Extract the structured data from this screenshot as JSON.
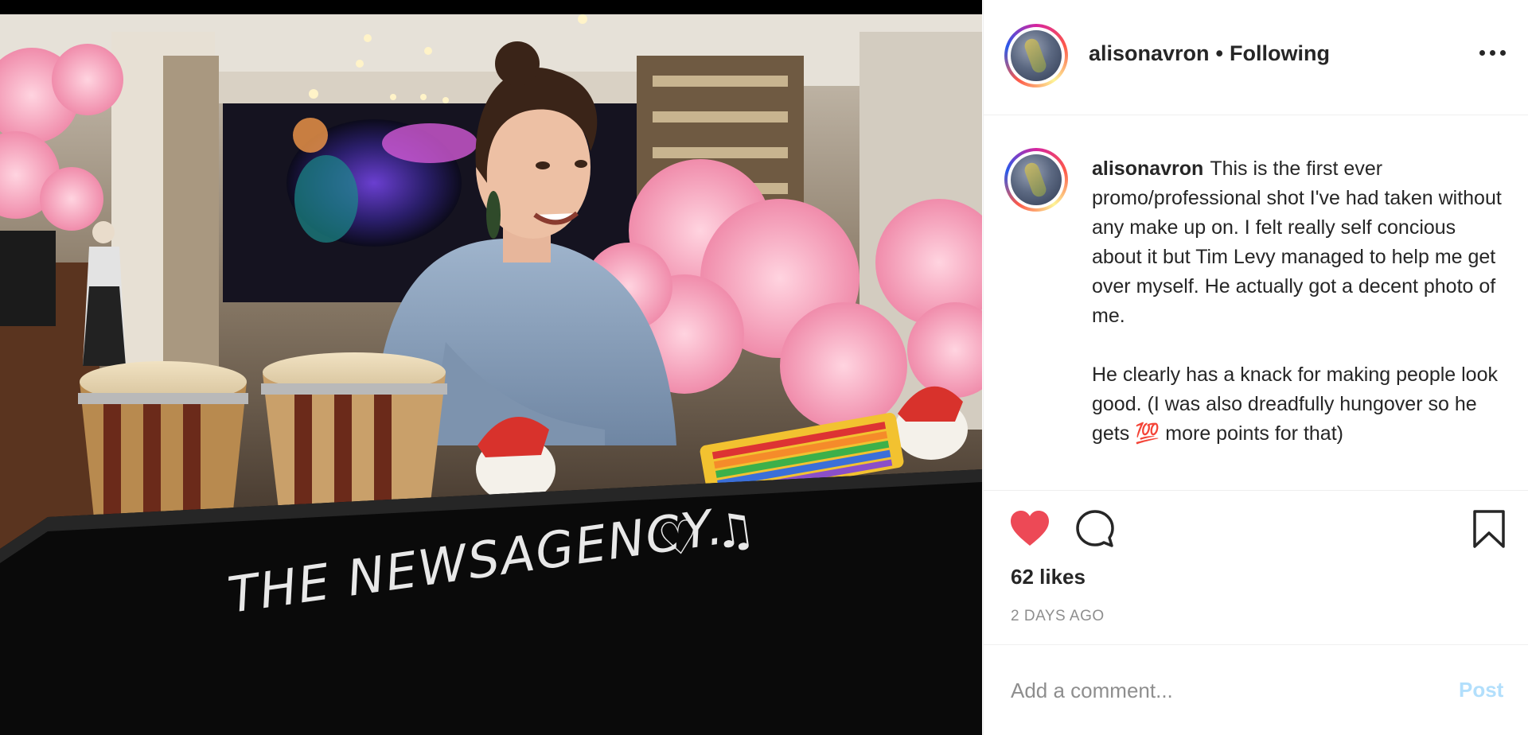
{
  "post": {
    "photo_sign_text": "THE NEWSAGENCY.",
    "photo_sign_symbols": "♡ ♫"
  },
  "header": {
    "username": "alisonavron",
    "separator": "•",
    "follow_status": "Following",
    "more_icon": "more-horizontal-icon"
  },
  "caption": {
    "username": "alisonavron",
    "paragraph1": "This is the first ever promo/professional shot I've had taken without any make up on. I felt really self concious about it but Tim Levy managed to help me get over myself. He actually got a decent photo of me.",
    "paragraph2": "He clearly has a knack for making people look good. (I was also dreadfully hungover so he gets 💯 more points for that)"
  },
  "actions": {
    "like_icon": "heart-filled-icon",
    "comment_icon": "comment-icon",
    "save_icon": "bookmark-icon",
    "liked": true
  },
  "stats": {
    "likes": "62 likes",
    "timestamp": "2 DAYS AGO"
  },
  "comment_box": {
    "placeholder": "Add a comment...",
    "post_label": "Post"
  },
  "colors": {
    "heart": "#ed4956",
    "post_disabled": "#b2dffc",
    "muted_text": "#8e8e8e"
  }
}
